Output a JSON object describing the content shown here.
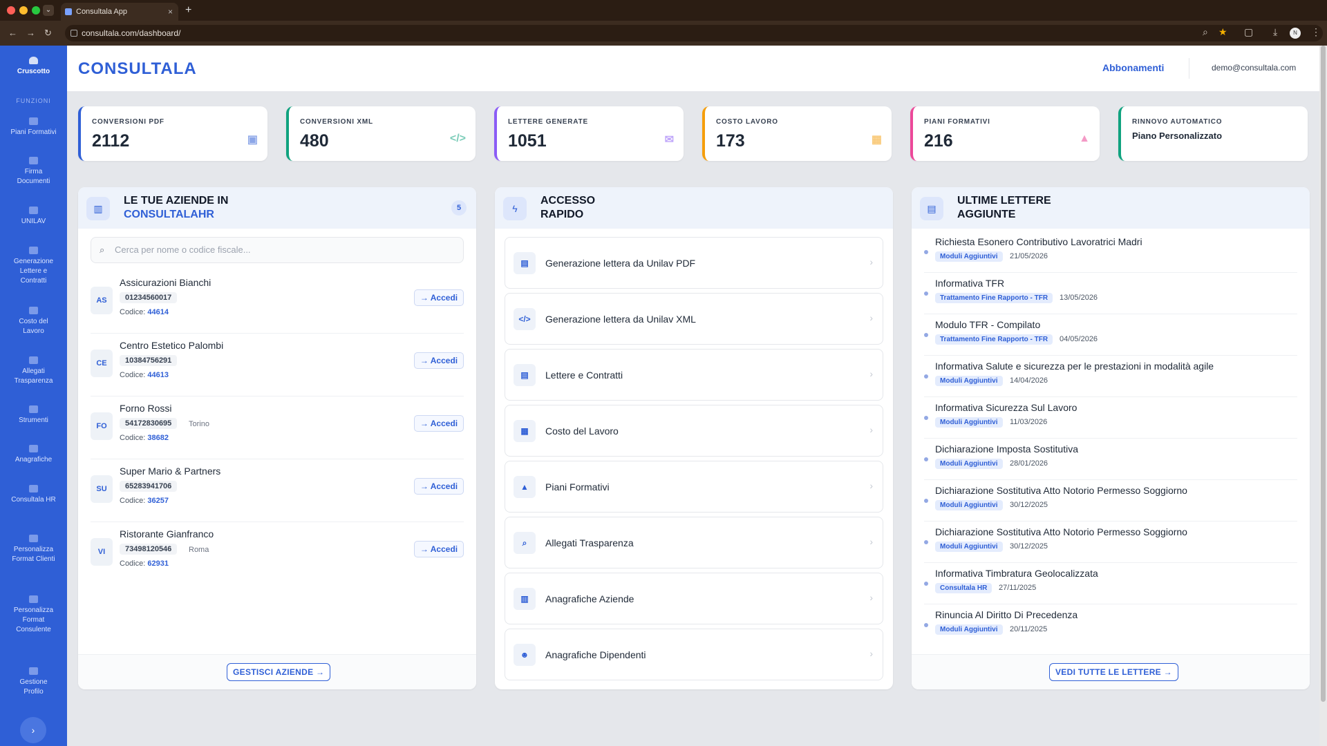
{
  "browser": {
    "tab_title": "Consultala App",
    "tab_close": "×",
    "new_tab": "+",
    "url": "consultala.com/dashboard/",
    "avatar": "N"
  },
  "sidebar": {
    "active": {
      "label": "Cruscotto",
      "icon": "dashboard-icon"
    },
    "section": "FUNZIONI",
    "items": [
      {
        "label": "Piani Formativi",
        "icon": "table-icon"
      },
      {
        "label": "Firma Documenti",
        "icon": "signature-icon"
      },
      {
        "label": "UNILAV",
        "icon": "gear-icon"
      },
      {
        "label": "Generazione Lettere e Contratti",
        "icon": "document-icon"
      },
      {
        "label": "Costo del Lavoro",
        "icon": "calculator-icon"
      },
      {
        "label": "Allegati Trasparenza",
        "icon": "search-icon"
      },
      {
        "label": "Strumenti",
        "icon": "tools-icon"
      },
      {
        "label": "Anagrafiche",
        "icon": "users-icon"
      },
      {
        "label": "Consultala HR",
        "icon": "folder-icon"
      },
      {
        "label": "Personalizza Format Clienti",
        "icon": "file-icon"
      },
      {
        "label": "Personalizza Format Consulente",
        "icon": "cog-icon"
      },
      {
        "label": "Gestione Profilo",
        "icon": "user-icon"
      }
    ],
    "toggle": "›"
  },
  "header": {
    "logo": "CONSULTALA",
    "link": "Abbonamenti",
    "user": "demo@consultala.com"
  },
  "stats": [
    {
      "label": "CONVERSIONI PDF",
      "value": "2112",
      "icon": "pdf-icon",
      "color": "#2f5fd6",
      "glyph": "▣"
    },
    {
      "label": "CONVERSIONI XML",
      "value": "480",
      "icon": "code-icon",
      "color": "#10a37f",
      "glyph": "</>"
    },
    {
      "label": "LETTERE GENERATE",
      "value": "1051",
      "icon": "envelope-icon",
      "color": "#8b5cf6",
      "glyph": "✉"
    },
    {
      "label": "COSTO LAVORO",
      "value": "173",
      "icon": "calculator-icon",
      "color": "#f59e0b",
      "glyph": "▦"
    },
    {
      "label": "PIANI FORMATIVI",
      "value": "216",
      "icon": "graduation-cap-icon",
      "color": "#ec4899",
      "glyph": "▲"
    },
    {
      "label": "RINNOVO AUTOMATICO",
      "value": "Piano Personalizzato",
      "color": "#10a37f"
    }
  ],
  "companies_card": {
    "title_1": "LE TUE AZIENDE IN",
    "title_2": "CONSULTALAHR",
    "count": "5",
    "search_placeholder": "Cerca per nome o codice fiscale...",
    "code_label": "Codice:",
    "access_label": "→ Accedi",
    "items": [
      {
        "initials": "AS",
        "name": "Assicurazioni Bianchi",
        "vat": "01234560017",
        "city": "",
        "code": "44614"
      },
      {
        "initials": "CE",
        "name": "Centro Estetico Palombi",
        "vat": "10384756291",
        "city": "",
        "code": "44613"
      },
      {
        "initials": "FO",
        "name": "Forno Rossi",
        "vat": "54172830695",
        "city": "Torino",
        "code": "38682"
      },
      {
        "initials": "SU",
        "name": "Super Mario & Partners",
        "vat": "65283941706",
        "city": "",
        "code": "36257"
      },
      {
        "initials": "VI",
        "name": "Ristorante Gianfranco",
        "vat": "73498120546",
        "city": "Roma",
        "code": "62931"
      }
    ],
    "footer_button": "GESTISCI AZIENDE →"
  },
  "quick_card": {
    "title_1": "ACCESSO",
    "title_2": "RAPIDO",
    "items": [
      {
        "label": "Generazione lettera da Unilav PDF",
        "icon": "pdf-icon",
        "glyph": "▤"
      },
      {
        "label": "Generazione lettera da Unilav XML",
        "icon": "code-icon",
        "glyph": "</>"
      },
      {
        "label": "Lettere e Contratti",
        "icon": "document-icon",
        "glyph": "▤"
      },
      {
        "label": "Costo del Lavoro",
        "icon": "calculator-icon",
        "glyph": "▦"
      },
      {
        "label": "Piani Formativi",
        "icon": "graduation-cap-icon",
        "glyph": "▲"
      },
      {
        "label": "Allegati Trasparenza",
        "icon": "search-icon",
        "glyph": "⌕"
      },
      {
        "label": "Anagrafiche Aziende",
        "icon": "building-icon",
        "glyph": "▥"
      },
      {
        "label": "Anagrafiche Dipendenti",
        "icon": "users-icon",
        "glyph": "☻"
      }
    ]
  },
  "letters_card": {
    "title_1": "ULTIME LETTERE",
    "title_2": "AGGIUNTE",
    "items": [
      {
        "title": "Richiesta Esonero Contributivo Lavoratrici Madri",
        "tag": "Moduli Aggiuntivi",
        "date": "21/05/2026"
      },
      {
        "title": "Informativa TFR",
        "tag": "Trattamento Fine Rapporto - TFR",
        "date": "13/05/2026"
      },
      {
        "title": "Modulo TFR - Compilato",
        "tag": "Trattamento Fine Rapporto - TFR",
        "date": "04/05/2026"
      },
      {
        "title": "Informativa Salute e sicurezza per le prestazioni in modalità agile",
        "tag": "Moduli Aggiuntivi",
        "date": "14/04/2026"
      },
      {
        "title": "Informativa Sicurezza Sul Lavoro",
        "tag": "Moduli Aggiuntivi",
        "date": "11/03/2026"
      },
      {
        "title": "Dichiarazione Imposta Sostitutiva",
        "tag": "Moduli Aggiuntivi",
        "date": "28/01/2026"
      },
      {
        "title": "Dichiarazione Sostitutiva Atto Notorio Permesso Soggiorno",
        "tag": "Moduli Aggiuntivi",
        "date": "30/12/2025"
      },
      {
        "title": "Dichiarazione Sostitutiva Atto Notorio Permesso Soggiorno",
        "tag": "Moduli Aggiuntivi",
        "date": "30/12/2025"
      },
      {
        "title": "Informativa Timbratura Geolocalizzata",
        "tag": "Consultala HR",
        "date": "27/11/2025"
      },
      {
        "title": "Rinuncia Al Diritto Di Precedenza",
        "tag": "Moduli Aggiuntivi",
        "date": "20/11/2025"
      }
    ],
    "footer_button": "VEDI TUTTE LE LETTERE →"
  }
}
